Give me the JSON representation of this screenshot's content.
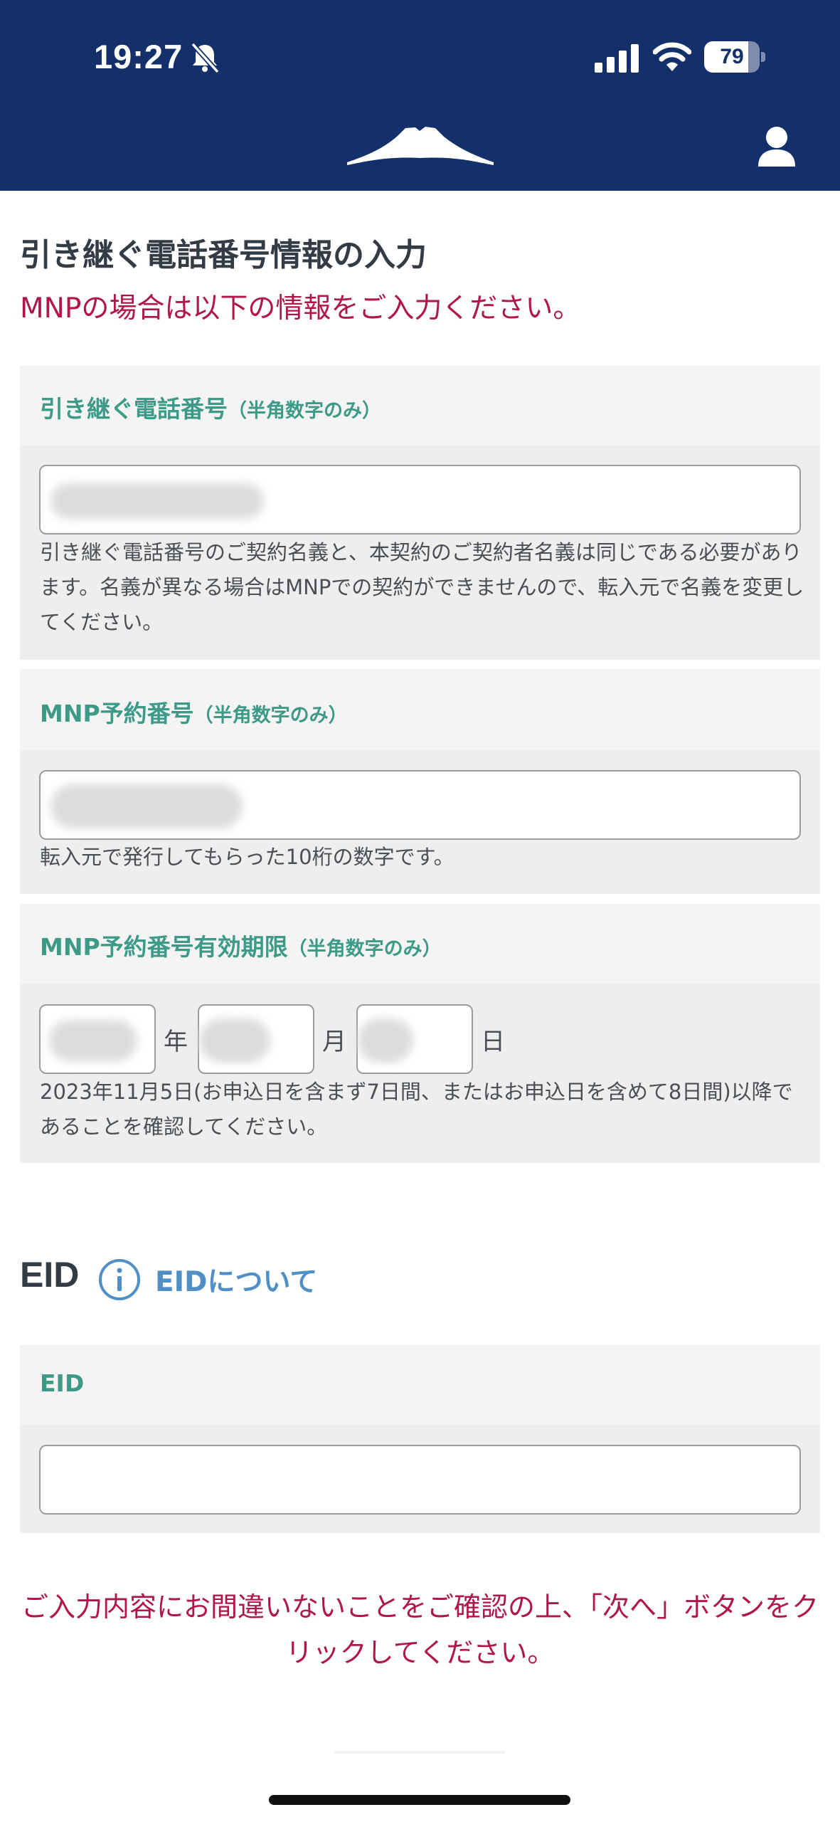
{
  "status_bar": {
    "time": "19:27",
    "battery": "79",
    "battery_level": 0.79
  },
  "header": {
    "logo_icon": "mount-fuji-logo",
    "account_icon": "user-icon",
    "color": "#13306b"
  },
  "form": {
    "title": "引き継ぐ電話番号情報の入力",
    "note": "MNPの場合は以下の情報をご入力ください。",
    "phone": {
      "label": "引き継ぐ電話番号",
      "hint": "（半角数字のみ）",
      "value": "",
      "help": "引き継ぐ電話番号のご契約名義と、本契約のご契約者名義は同じである必要があります。名義が異なる場合はMNPでの契約ができませんので、転入元で名義を変更してください。"
    },
    "reservation": {
      "label": "MNP予約番号",
      "hint": "（半角数字のみ）",
      "value": "",
      "help": "転入元で発行してもらった10桁の数字です。"
    },
    "expiry": {
      "label": "MNP予約番号有効期限",
      "hint": "（半角数字のみ）",
      "year_unit": "年",
      "month_unit": "月",
      "day_unit": "日",
      "year": "",
      "month": "",
      "day": "",
      "help": "2023年11月5日(お申込日を含まず7日間、またはお申込日を含めて8日間)以降であることを確認してください。"
    }
  },
  "eid_section": {
    "title": "EID",
    "info_icon": "info-icon",
    "link": "EIDについて",
    "field_label": "EID",
    "value": ""
  },
  "confirm_note": "ご入力内容にお間違いないことをご確認の上、「次へ」ボタンをクリックしてください。",
  "colors": {
    "accent_label": "#3c9a86",
    "notice": "#b0164a",
    "link": "#4f8fc6"
  }
}
